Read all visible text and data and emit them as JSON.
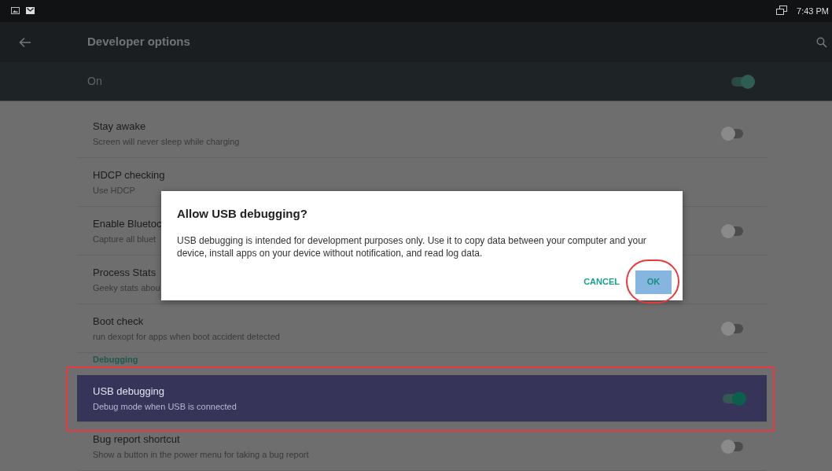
{
  "status_bar": {
    "time": "7:43 PM"
  },
  "toolbar": {
    "title": "Developer options"
  },
  "master_switch": {
    "label": "On",
    "on": true
  },
  "settings": [
    {
      "kind": "toggle",
      "title": "Stay awake",
      "subtitle": "Screen will never sleep while charging",
      "on": false,
      "selected": false
    },
    {
      "kind": "plain",
      "title": "HDCP checking",
      "subtitle": "Use HDCP",
      "selected": false
    },
    {
      "kind": "toggle",
      "title": "Enable Bluetoc",
      "subtitle": "Capture all bluet",
      "on": false,
      "selected": false
    },
    {
      "kind": "plain",
      "title": "Process Stats",
      "subtitle": "Geeky stats abou",
      "selected": false
    },
    {
      "kind": "toggle",
      "title": "Boot check",
      "subtitle": "run dexopt for apps when boot accident detected",
      "on": false,
      "selected": false
    },
    {
      "kind": "header",
      "title": "Debugging"
    },
    {
      "kind": "toggle",
      "title": "USB debugging",
      "subtitle": "Debug mode when USB is connected",
      "on": true,
      "selected": true
    },
    {
      "kind": "toggle",
      "title": "Bug report shortcut",
      "subtitle": "Show a button in the power menu for taking a bug report",
      "on": false,
      "selected": false
    }
  ],
  "dialog": {
    "title": "Allow USB debugging?",
    "message": "USB debugging is intended for development purposes only. Use it to copy data between your computer and your device, install apps on your device without notification, and read log data.",
    "buttons": [
      {
        "label": "CANCEL",
        "kind": "text"
      },
      {
        "label": "OK",
        "kind": "filled"
      }
    ]
  }
}
